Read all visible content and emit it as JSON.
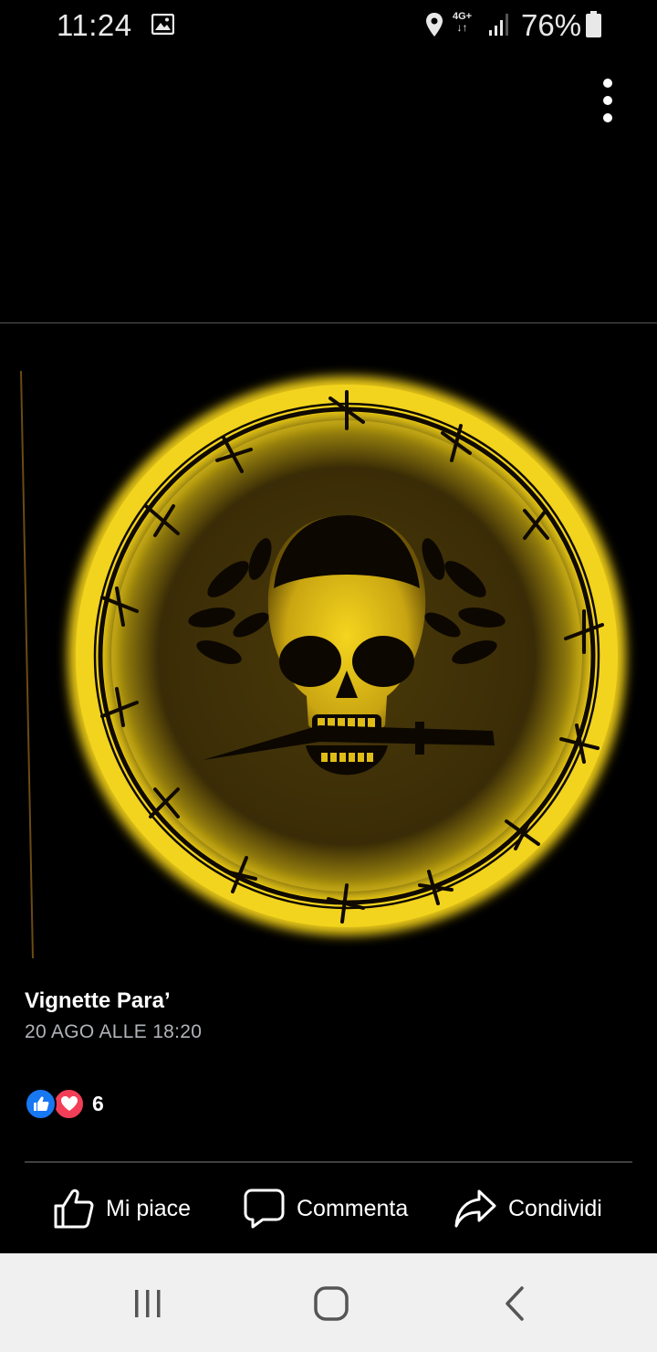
{
  "status_bar": {
    "time": "11:24",
    "network_line1": "4G+",
    "battery_percent": "76%",
    "icons": [
      "gallery-icon",
      "location-icon",
      "signal-icon",
      "battery-icon"
    ]
  },
  "toolbar": {
    "more_icon": "more-vertical-icon"
  },
  "photo": {
    "subject": "skull-emblem",
    "colors": {
      "glow": "#f5d31c",
      "fill": "#3c2e08",
      "ink": "#0a0600"
    }
  },
  "post": {
    "author": "Vignette Para’",
    "date": "20 AGO ALLE 18:20"
  },
  "reactions": {
    "types": [
      "like",
      "love"
    ],
    "count": "6",
    "colors": {
      "like": "#1877f2",
      "love": "#f33e58"
    }
  },
  "actions": {
    "like_label": "Mi piace",
    "comment_label": "Commenta",
    "share_label": "Condividi"
  },
  "nav": {
    "icons": [
      "recents-icon",
      "home-icon",
      "back-icon"
    ]
  }
}
